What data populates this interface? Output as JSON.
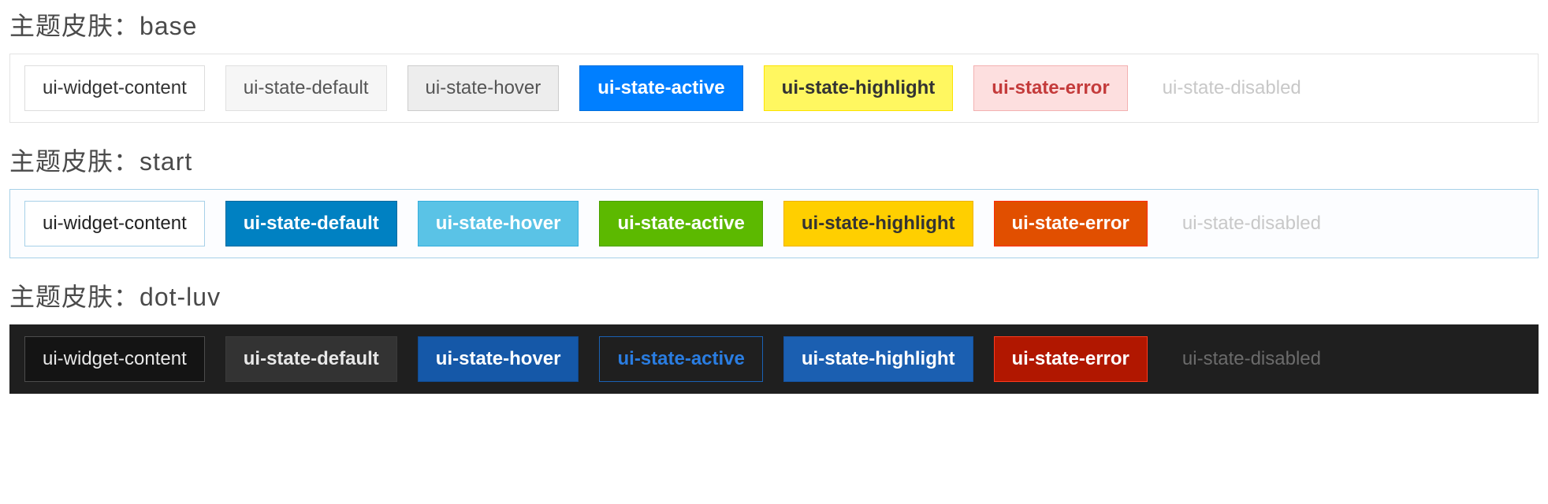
{
  "titlePrefix": "主题皮肤：",
  "stateLabels": {
    "content": "ui-widget-content",
    "default": "ui-state-default",
    "hover": "ui-state-hover",
    "active": "ui-state-active",
    "highlight": "ui-state-highlight",
    "error": "ui-state-error",
    "disabled": "ui-state-disabled"
  },
  "themes": [
    {
      "name": "base"
    },
    {
      "name": "start"
    },
    {
      "name": "dot-luv"
    }
  ]
}
